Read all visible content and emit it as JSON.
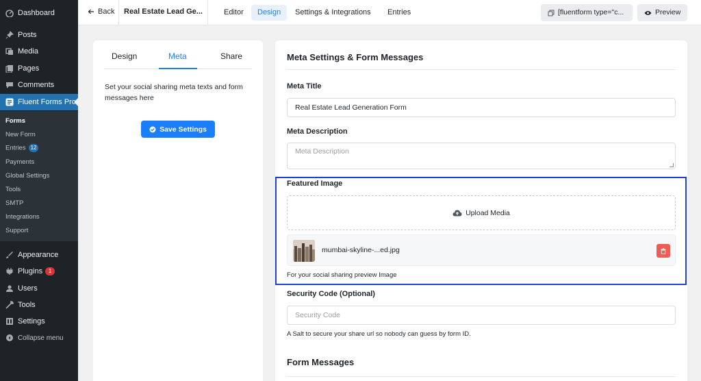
{
  "wp_menu": {
    "dashboard": "Dashboard",
    "posts": "Posts",
    "media": "Media",
    "pages": "Pages",
    "comments": "Comments",
    "fluent_forms": "Fluent Forms Pro",
    "submenu": {
      "forms": "Forms",
      "new_form": "New Form",
      "entries": "Entries",
      "entries_count": "12",
      "payments": "Payments",
      "global_settings": "Global Settings",
      "tools": "Tools",
      "smtp": "SMTP",
      "integrations": "Integrations",
      "support": "Support"
    },
    "appearance": "Appearance",
    "plugins": "Plugins",
    "plugins_count": "1",
    "users": "Users",
    "tools": "Tools",
    "settings": "Settings",
    "collapse": "Collapse menu"
  },
  "topbar": {
    "back": "Back",
    "form_title": "Real Estate Lead Ge...",
    "tabs": [
      "Editor",
      "Design",
      "Settings & Integrations",
      "Entries"
    ],
    "shortcode": "[fluentform type=\"c...",
    "preview": "Preview"
  },
  "left_panel": {
    "tabs": [
      "Design",
      "Meta",
      "Share"
    ],
    "description": "Set your social sharing meta texts and form messages here",
    "save_button": "Save Settings"
  },
  "right_panel": {
    "heading": "Meta Settings & Form Messages",
    "meta_title_label": "Meta Title",
    "meta_title_value": "Real Estate Lead Generation Form",
    "meta_description_label": "Meta Description",
    "meta_description_placeholder": "Meta Description",
    "featured_image_label": "Featured Image",
    "upload_media": "Upload Media",
    "file_name": "mumbai-skyline-...ed.jpg",
    "featured_image_help": "For your social sharing preview Image",
    "security_code_label": "Security Code (Optional)",
    "security_code_placeholder": "Security Code",
    "security_code_help": "A Salt to secure your share url so nobody can guess by form ID.",
    "form_messages_heading": "Form Messages"
  },
  "colors": {
    "accent": "#1a7efb",
    "wp_sidebar": "#1d2327",
    "wp_active": "#2271b1",
    "danger": "#ef5b55",
    "highlight": "#1e40d6"
  }
}
